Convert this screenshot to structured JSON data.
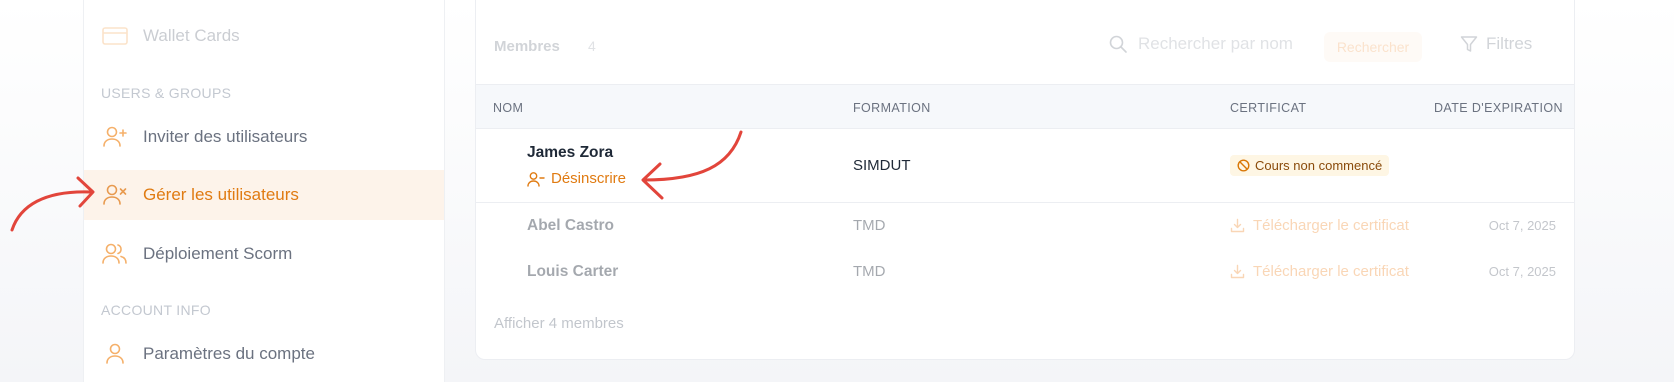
{
  "sidebar": {
    "wallet_label": "Wallet Cards",
    "users_section": "USERS & GROUPS",
    "items": [
      {
        "label": "Inviter des utilisateurs",
        "icon": "user-plus-icon"
      },
      {
        "label": "Gérer les utilisateurs",
        "icon": "user-x-icon"
      },
      {
        "label": "Déploiement Scorm",
        "icon": "users-icon"
      }
    ],
    "account_section": "ACCOUNT INFO",
    "account_label": "Paramètres du compte"
  },
  "toolbar": {
    "members_label": "Membres",
    "members_count": "4",
    "search_placeholder": "Rechercher par nom",
    "search_button": "Rechercher",
    "filters_label": "Filtres"
  },
  "table": {
    "headers": [
      "NOM",
      "FORMATION",
      "CERTIFICAT",
      "DATE D'EXPIRATION"
    ],
    "rows": [
      {
        "name": "James Zora",
        "action": "Désinscrire",
        "course": "SIMDUT",
        "status": "Cours non commencé",
        "date": ""
      },
      {
        "name": "Abel Castro",
        "course": "TMD",
        "certificate": "Télécharger le certificat",
        "date": "Oct 7, 2025"
      },
      {
        "name": "Louis Carter",
        "course": "TMD",
        "certificate": "Télécharger le certificat",
        "date": "Oct 7, 2025"
      }
    ],
    "show_more": "Afficher 4 membres"
  },
  "colors": {
    "accent": "#e07b12",
    "active_bg": "#fdf3ea",
    "annotation_arrow": "#e2453b"
  }
}
